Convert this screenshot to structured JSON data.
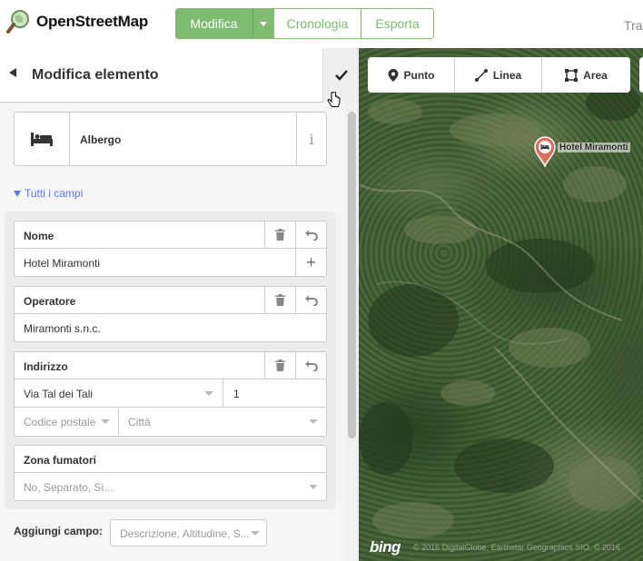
{
  "header": {
    "logo_text": "OpenStreetMap",
    "edit_label": "Modifica",
    "history_label": "Cronologia",
    "export_label": "Esporta",
    "right_text": "Tra"
  },
  "sidebar": {
    "title": "Modifica elemento",
    "preset_name": "Albergo",
    "all_fields_label": "Tutti i campi",
    "fields": {
      "name": {
        "label": "Nome",
        "value": "Hotel Miramonti"
      },
      "operator": {
        "label": "Operatore",
        "value": "Miramonti s.n.c."
      },
      "address": {
        "label": "Indirizzo",
        "street": "Via Tal dei Tali",
        "housenumber": "1",
        "postcode_placeholder": "Codice postale",
        "city_placeholder": "Città"
      },
      "smoking": {
        "label": "Zona fumatori",
        "placeholder": "No, Separato, Sì..."
      }
    },
    "add_field_label": "Aggiungi campo:",
    "add_field_placeholder": "Descrizione, Altitudine, S..."
  },
  "map": {
    "tools": [
      "Punto",
      "Linea",
      "Area"
    ],
    "pin_label": "Hotel Miramonti",
    "imagery_logo": "bing",
    "attribution": "© 2016 DigitalGlobe, Earthstar Geographics SIO, © 2016"
  },
  "colors": {
    "accent_green": "#7ebc6f",
    "link_blue": "#597be7",
    "pin_red": "#e06e5f"
  }
}
